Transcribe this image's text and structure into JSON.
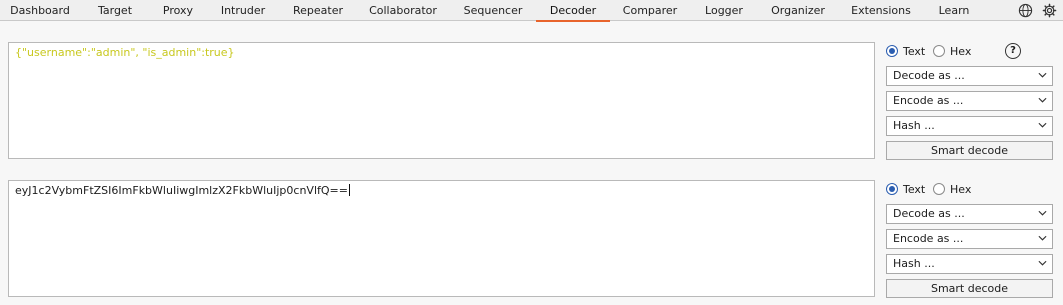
{
  "nav": {
    "tabs": [
      {
        "label": "Dashboard"
      },
      {
        "label": "Target"
      },
      {
        "label": "Proxy"
      },
      {
        "label": "Intruder"
      },
      {
        "label": "Repeater"
      },
      {
        "label": "Collaborator"
      },
      {
        "label": "Sequencer"
      },
      {
        "label": "Decoder"
      },
      {
        "label": "Comparer"
      },
      {
        "label": "Logger"
      },
      {
        "label": "Organizer"
      },
      {
        "label": "Extensions"
      },
      {
        "label": "Learn"
      }
    ],
    "active_tab": "Decoder",
    "accent_color": "#e8642c",
    "icons": [
      "globe-icon",
      "gear-icon"
    ]
  },
  "panels": [
    {
      "content": "{\"username\":\"admin\", \"is_admin\":true}",
      "text_color": "#c8c81e",
      "radio_text": "Text",
      "radio_hex": "Hex",
      "selected_mode": "Text",
      "help": "?",
      "decode_as": "Decode as ...",
      "encode_as": "Encode as ...",
      "hash": "Hash ...",
      "smart_decode": "Smart decode"
    },
    {
      "content": "eyJ1c2VybmFtZSI6ImFkbWluIiwgImlzX2FkbWluIjp0cnVlfQ==",
      "radio_text": "Text",
      "radio_hex": "Hex",
      "selected_mode": "Text",
      "decode_as": "Decode as ...",
      "encode_as": "Encode as ...",
      "hash": "Hash ...",
      "smart_decode": "Smart decode"
    }
  ]
}
